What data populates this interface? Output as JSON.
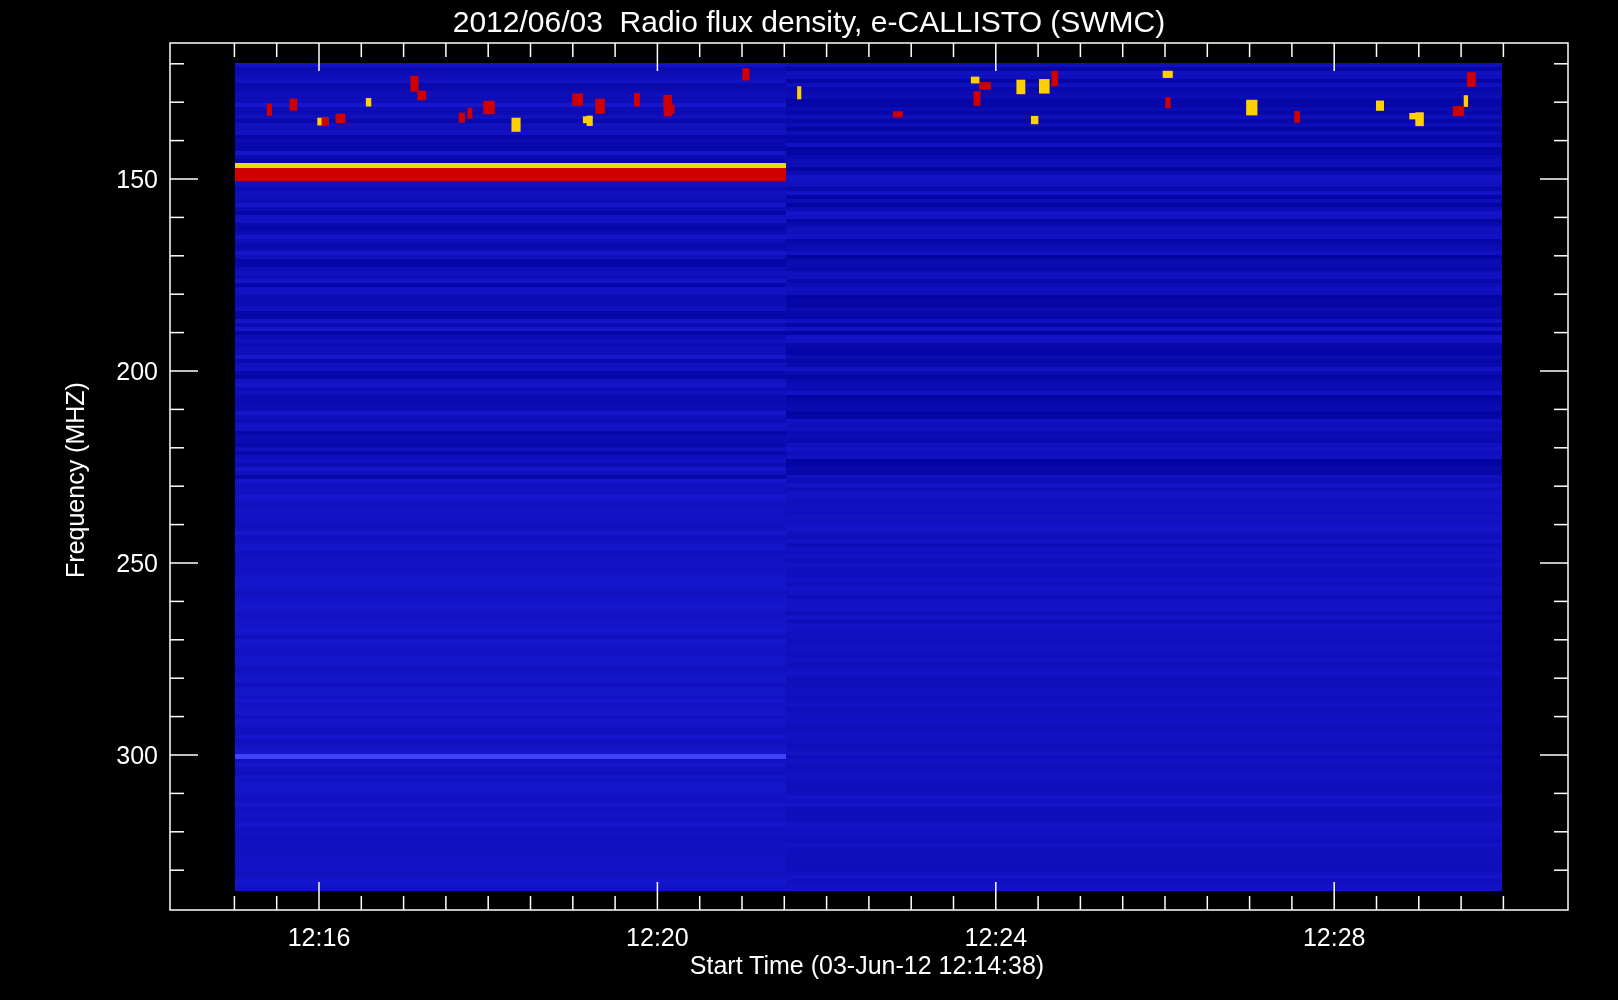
{
  "title": "2012/06/03  Radio flux density, e-CALLISTO (SWMC)",
  "y_axis": {
    "label": "Frequency (MHZ)",
    "ticks": [
      "150",
      "200",
      "250",
      "300"
    ]
  },
  "x_axis": {
    "label": "Start Time (03-Jun-12 12:14:38)",
    "ticks": [
      "12:16",
      "12:20",
      "12:24",
      "12:28"
    ]
  }
}
